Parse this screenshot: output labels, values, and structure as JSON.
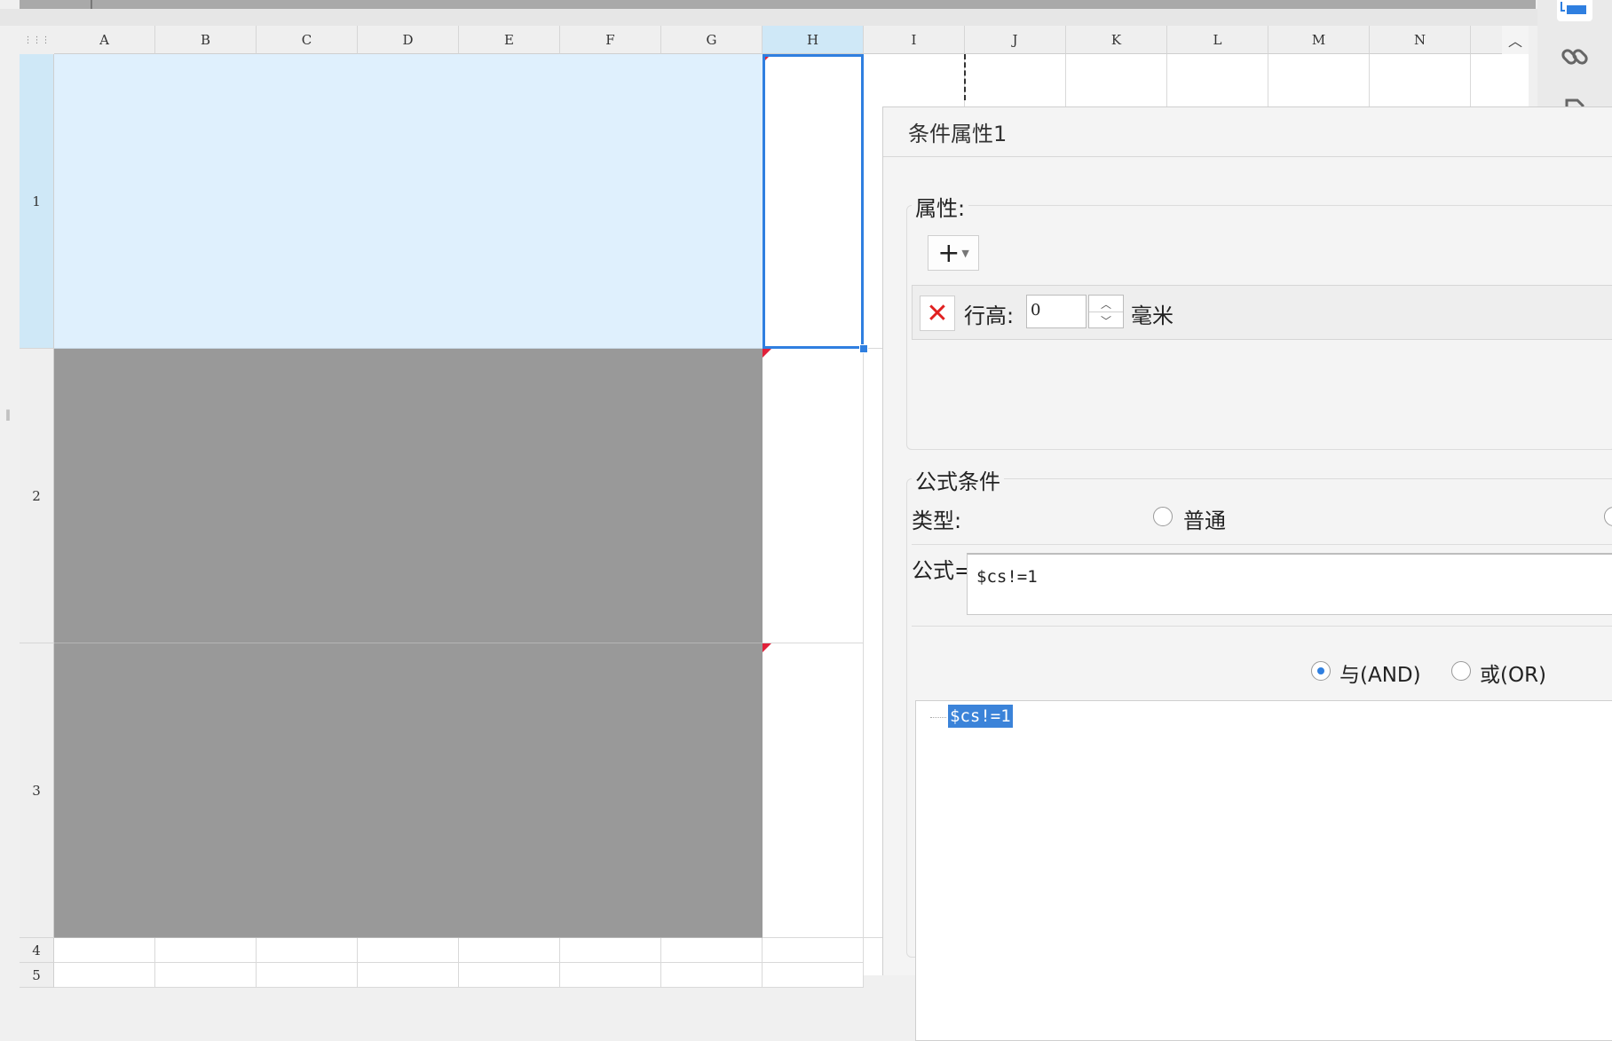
{
  "sheet": {
    "corner_icon": "select-all-grid-icon",
    "columns": [
      "A",
      "B",
      "C",
      "D",
      "E",
      "F",
      "G",
      "H",
      "I",
      "J",
      "K",
      "L",
      "M",
      "N"
    ],
    "selected_column": "H",
    "rows": [
      "1",
      "2",
      "3",
      "4",
      "5"
    ],
    "selected_row": "1",
    "collapse_icon": "chevron-up-icon"
  },
  "right_toolbar": {
    "icons": [
      "panel-icon",
      "link-icon",
      "document-icon"
    ]
  },
  "dialog": {
    "title": "条件属性1",
    "properties": {
      "legend": "属性:",
      "add_button_icon": "plus-icon",
      "rows": [
        {
          "delete_icon": "close-icon",
          "label": "行高:",
          "value": "0",
          "unit": "毫米"
        }
      ]
    },
    "formula_condition": {
      "legend": "公式条件",
      "type_label": "类型:",
      "type_options": [
        {
          "label": "普通",
          "checked": false
        }
      ],
      "formula_label": "公式=",
      "formula_value": "$cs!=1",
      "logic_options": [
        {
          "label": "与(AND)",
          "checked": true
        },
        {
          "label": "或(OR)",
          "checked": false
        }
      ],
      "tree_nodes": [
        "$cs!=1"
      ]
    }
  },
  "colors": {
    "selection": "#2f7fe0",
    "merged_light": "#dff0fd",
    "merged_gray": "#999999",
    "flag_red": "#e1213a"
  }
}
